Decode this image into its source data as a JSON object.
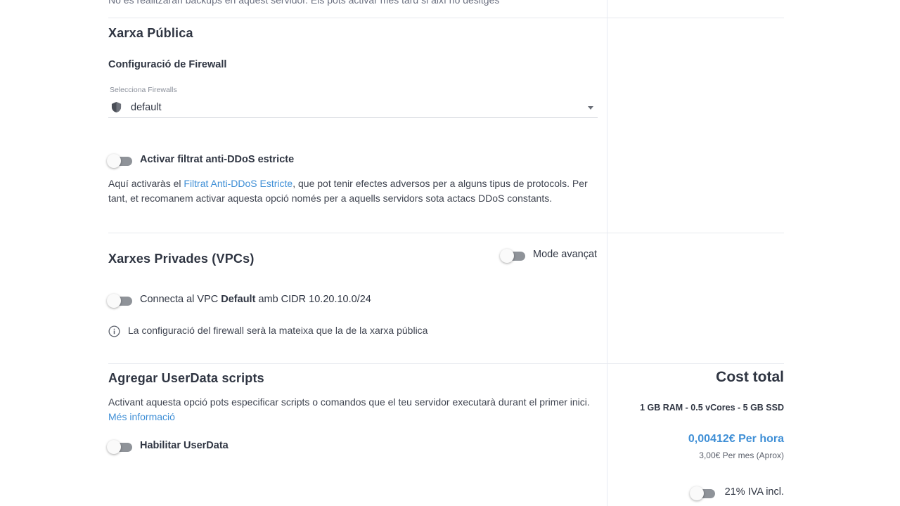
{
  "top_cut_text": "No es realitzaran backups en aquest servidor. Els pots activar més tard si així ho desitges",
  "public_network": {
    "title": "Xarxa Pública",
    "firewall_heading": "Configuració de Firewall",
    "firewall_select_label": "Selecciona Firewalls",
    "firewall_selected": "default",
    "ddos_toggle_label": "Activar filtrat anti-DDoS estricte",
    "ddos_toggle_on": false,
    "ddos_desc_before": "Aquí activaràs el ",
    "ddos_desc_link": "Filtrat Anti-DDoS Estricte",
    "ddos_desc_after": ", que pot tenir efectes adversos per a alguns tipus de protocols. Per tant, et recomanem activar aquesta opció només per a aquells servidors sota actacs DDoS constants."
  },
  "private_networks": {
    "title": "Xarxes Privades (VPCs)",
    "advanced_mode_label": "Mode avançat",
    "advanced_mode_on": false,
    "connect_prefix": "Connecta al VPC ",
    "vpc_name": "Default",
    "connect_mid": " amb CIDR ",
    "cidr": "10.20.10.0/24",
    "connect_on": false,
    "info_text": "La configuració del firewall serà la mateixa que la de la xarxa pública"
  },
  "userdata": {
    "title": "Agregar UserData scripts",
    "desc": "Activant aquesta opció pots especificar scripts o comandos que el teu servidor executarà durant el primer inici. ",
    "more_info_link": "Més informació",
    "toggle_label": "Habilitar UserData",
    "toggle_on": false
  },
  "cost": {
    "title": "Cost total",
    "spec": "1 GB RAM - 0.5 vCores - 5 GB SSD",
    "price_hour": "0,00412€ Per hora",
    "price_month": "3,00€ Per mes (Aprox)",
    "vat_label": "21% IVA incl.",
    "vat_on": false
  },
  "colors": {
    "accent": "#3f8fd6",
    "toggle_track": "#8f9399",
    "divider": "#e7e9ee"
  }
}
